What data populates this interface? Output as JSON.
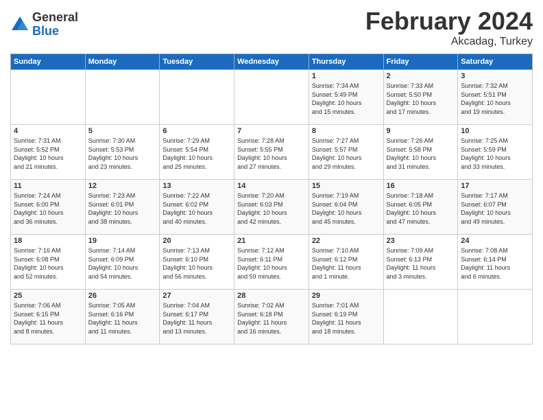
{
  "logo": {
    "general": "General",
    "blue": "Blue"
  },
  "title": "February 2024",
  "location": "Akcadag, Turkey",
  "days_of_week": [
    "Sunday",
    "Monday",
    "Tuesday",
    "Wednesday",
    "Thursday",
    "Friday",
    "Saturday"
  ],
  "weeks": [
    [
      {
        "day": "",
        "info": ""
      },
      {
        "day": "",
        "info": ""
      },
      {
        "day": "",
        "info": ""
      },
      {
        "day": "",
        "info": ""
      },
      {
        "day": "1",
        "info": "Sunrise: 7:34 AM\nSunset: 5:49 PM\nDaylight: 10 hours\nand 15 minutes."
      },
      {
        "day": "2",
        "info": "Sunrise: 7:33 AM\nSunset: 5:50 PM\nDaylight: 10 hours\nand 17 minutes."
      },
      {
        "day": "3",
        "info": "Sunrise: 7:32 AM\nSunset: 5:51 PM\nDaylight: 10 hours\nand 19 minutes."
      }
    ],
    [
      {
        "day": "4",
        "info": "Sunrise: 7:31 AM\nSunset: 5:52 PM\nDaylight: 10 hours\nand 21 minutes."
      },
      {
        "day": "5",
        "info": "Sunrise: 7:30 AM\nSunset: 5:53 PM\nDaylight: 10 hours\nand 23 minutes."
      },
      {
        "day": "6",
        "info": "Sunrise: 7:29 AM\nSunset: 5:54 PM\nDaylight: 10 hours\nand 25 minutes."
      },
      {
        "day": "7",
        "info": "Sunrise: 7:28 AM\nSunset: 5:55 PM\nDaylight: 10 hours\nand 27 minutes."
      },
      {
        "day": "8",
        "info": "Sunrise: 7:27 AM\nSunset: 5:57 PM\nDaylight: 10 hours\nand 29 minutes."
      },
      {
        "day": "9",
        "info": "Sunrise: 7:26 AM\nSunset: 5:58 PM\nDaylight: 10 hours\nand 31 minutes."
      },
      {
        "day": "10",
        "info": "Sunrise: 7:25 AM\nSunset: 5:59 PM\nDaylight: 10 hours\nand 33 minutes."
      }
    ],
    [
      {
        "day": "11",
        "info": "Sunrise: 7:24 AM\nSunset: 6:00 PM\nDaylight: 10 hours\nand 36 minutes."
      },
      {
        "day": "12",
        "info": "Sunrise: 7:23 AM\nSunset: 6:01 PM\nDaylight: 10 hours\nand 38 minutes."
      },
      {
        "day": "13",
        "info": "Sunrise: 7:22 AM\nSunset: 6:02 PM\nDaylight: 10 hours\nand 40 minutes."
      },
      {
        "day": "14",
        "info": "Sunrise: 7:20 AM\nSunset: 6:03 PM\nDaylight: 10 hours\nand 42 minutes."
      },
      {
        "day": "15",
        "info": "Sunrise: 7:19 AM\nSunset: 6:04 PM\nDaylight: 10 hours\nand 45 minutes."
      },
      {
        "day": "16",
        "info": "Sunrise: 7:18 AM\nSunset: 6:05 PM\nDaylight: 10 hours\nand 47 minutes."
      },
      {
        "day": "17",
        "info": "Sunrise: 7:17 AM\nSunset: 6:07 PM\nDaylight: 10 hours\nand 49 minutes."
      }
    ],
    [
      {
        "day": "18",
        "info": "Sunrise: 7:16 AM\nSunset: 6:08 PM\nDaylight: 10 hours\nand 52 minutes."
      },
      {
        "day": "19",
        "info": "Sunrise: 7:14 AM\nSunset: 6:09 PM\nDaylight: 10 hours\nand 54 minutes."
      },
      {
        "day": "20",
        "info": "Sunrise: 7:13 AM\nSunset: 6:10 PM\nDaylight: 10 hours\nand 56 minutes."
      },
      {
        "day": "21",
        "info": "Sunrise: 7:12 AM\nSunset: 6:11 PM\nDaylight: 10 hours\nand 59 minutes."
      },
      {
        "day": "22",
        "info": "Sunrise: 7:10 AM\nSunset: 6:12 PM\nDaylight: 11 hours\nand 1 minute."
      },
      {
        "day": "23",
        "info": "Sunrise: 7:09 AM\nSunset: 6:13 PM\nDaylight: 11 hours\nand 3 minutes."
      },
      {
        "day": "24",
        "info": "Sunrise: 7:08 AM\nSunset: 6:14 PM\nDaylight: 11 hours\nand 6 minutes."
      }
    ],
    [
      {
        "day": "25",
        "info": "Sunrise: 7:06 AM\nSunset: 6:15 PM\nDaylight: 11 hours\nand 8 minutes."
      },
      {
        "day": "26",
        "info": "Sunrise: 7:05 AM\nSunset: 6:16 PM\nDaylight: 11 hours\nand 11 minutes."
      },
      {
        "day": "27",
        "info": "Sunrise: 7:04 AM\nSunset: 6:17 PM\nDaylight: 11 hours\nand 13 minutes."
      },
      {
        "day": "28",
        "info": "Sunrise: 7:02 AM\nSunset: 6:18 PM\nDaylight: 11 hours\nand 16 minutes."
      },
      {
        "day": "29",
        "info": "Sunrise: 7:01 AM\nSunset: 6:19 PM\nDaylight: 11 hours\nand 18 minutes."
      },
      {
        "day": "",
        "info": ""
      },
      {
        "day": "",
        "info": ""
      }
    ]
  ]
}
